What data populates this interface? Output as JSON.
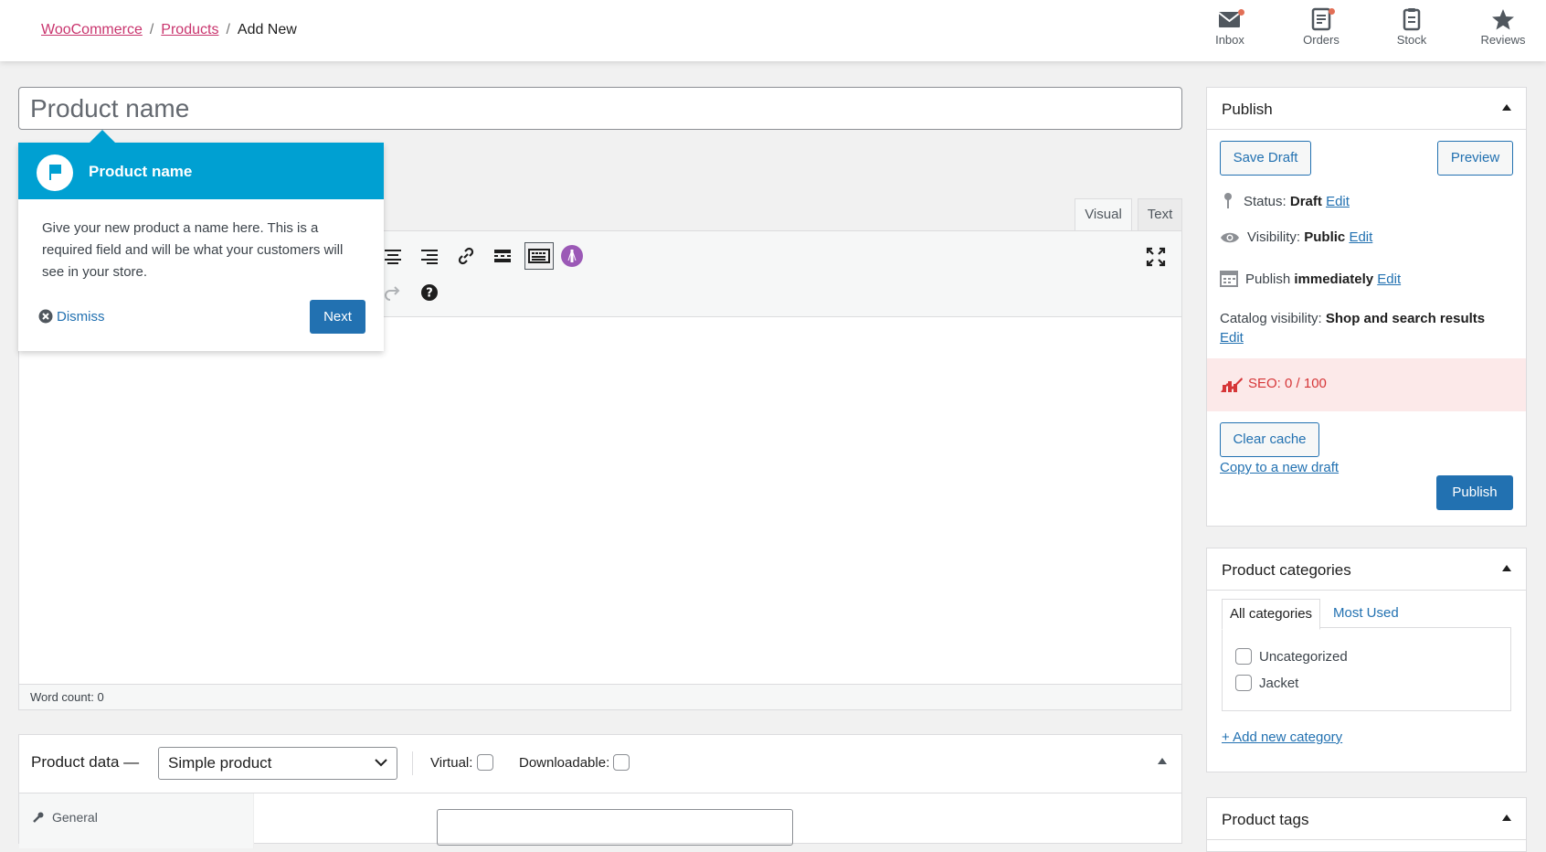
{
  "header": {
    "breadcrumb": {
      "woocommerce": "WooCommerce",
      "products": "Products",
      "sep": "/",
      "current": "Add New"
    },
    "activity": [
      {
        "label": "Inbox",
        "icon": "inbox-icon"
      },
      {
        "label": "Orders",
        "icon": "orders-icon"
      },
      {
        "label": "Stock",
        "icon": "stock-icon"
      },
      {
        "label": "Reviews",
        "icon": "star-icon"
      }
    ]
  },
  "title_field": {
    "placeholder": "Product name"
  },
  "tour": {
    "title": "Product name",
    "body": "Give your new product a name here. This is a required field and will be what your customers will see in your store.",
    "dismiss": "Dismiss",
    "next": "Next"
  },
  "editor": {
    "tabs": {
      "visual": "Visual",
      "text": "Text"
    },
    "word_count": "Word count: 0"
  },
  "product_data": {
    "title": "Product data —",
    "type_selected": "Simple product",
    "virtual_label": "Virtual:",
    "downloadable_label": "Downloadable:",
    "side_first": "General"
  },
  "publish": {
    "title": "Publish",
    "save_draft": "Save Draft",
    "preview": "Preview",
    "status_label": "Status:",
    "status_value": "Draft",
    "visibility_label": "Visibility:",
    "visibility_value": "Public",
    "publish_label": "Publish",
    "publish_value": "immediately",
    "edit": "Edit",
    "catalog_label": "Catalog visibility:",
    "catalog_value": "Shop and search results",
    "seo": "SEO: 0 / 100",
    "clear_cache": "Clear cache",
    "copy_draft": "Copy to a new draft",
    "publish_button": "Publish"
  },
  "categories": {
    "title": "Product categories",
    "tab_all": "All categories",
    "tab_used": "Most Used",
    "items": [
      "Uncategorized",
      "Jacket"
    ],
    "add_new": "+ Add new category"
  },
  "tags": {
    "title": "Product tags"
  },
  "colors": {
    "accent": "#2271b1",
    "tour": "#00a0d2",
    "breadcrumb_link": "#c9356e",
    "seo_bg": "#fce9e9",
    "seo_text": "#d63638"
  }
}
